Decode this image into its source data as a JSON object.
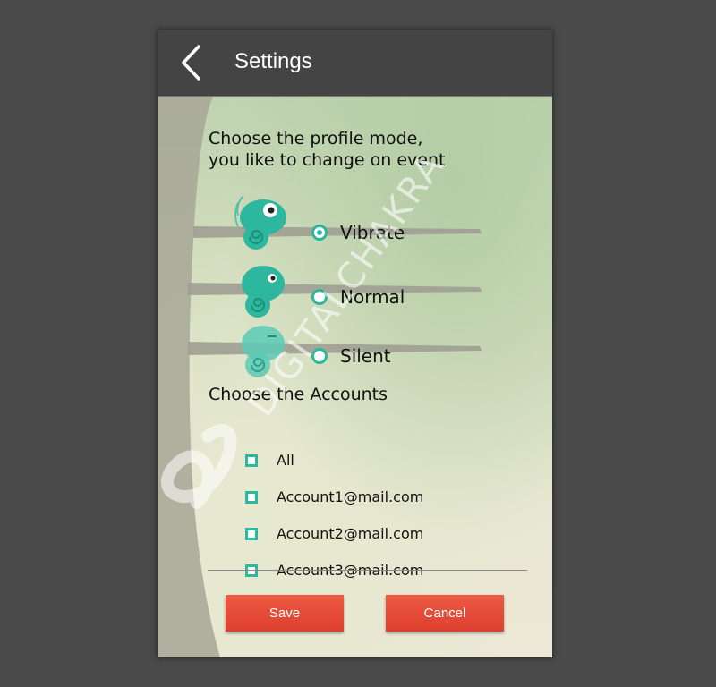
{
  "appbar": {
    "title": "Settings",
    "back_icon": "chevron-left-icon"
  },
  "profile": {
    "prompt": "Choose the profile mode,\nyou like to change on event",
    "options": [
      {
        "label": "Vibrate",
        "checked": true,
        "icon": "chameleon-vibrate-icon"
      },
      {
        "label": "Normal",
        "checked": false,
        "icon": "chameleon-normal-icon"
      },
      {
        "label": "Silent",
        "checked": false,
        "icon": "chameleon-silent-icon"
      }
    ]
  },
  "accounts": {
    "title": "Choose the Accounts",
    "items": [
      {
        "label": "All",
        "checked": false
      },
      {
        "label": "Account1@mail.com",
        "checked": false
      },
      {
        "label": "Account2@mail.com",
        "checked": false
      },
      {
        "label": "Account3@mail.com",
        "checked": false
      }
    ]
  },
  "actions": {
    "save_label": "Save",
    "cancel_label": "Cancel"
  },
  "watermark": {
    "text": "DIGITALCHAKRA"
  },
  "colors": {
    "accent": "#2cb79e",
    "button": "#e04a36",
    "appbar": "#444444"
  }
}
